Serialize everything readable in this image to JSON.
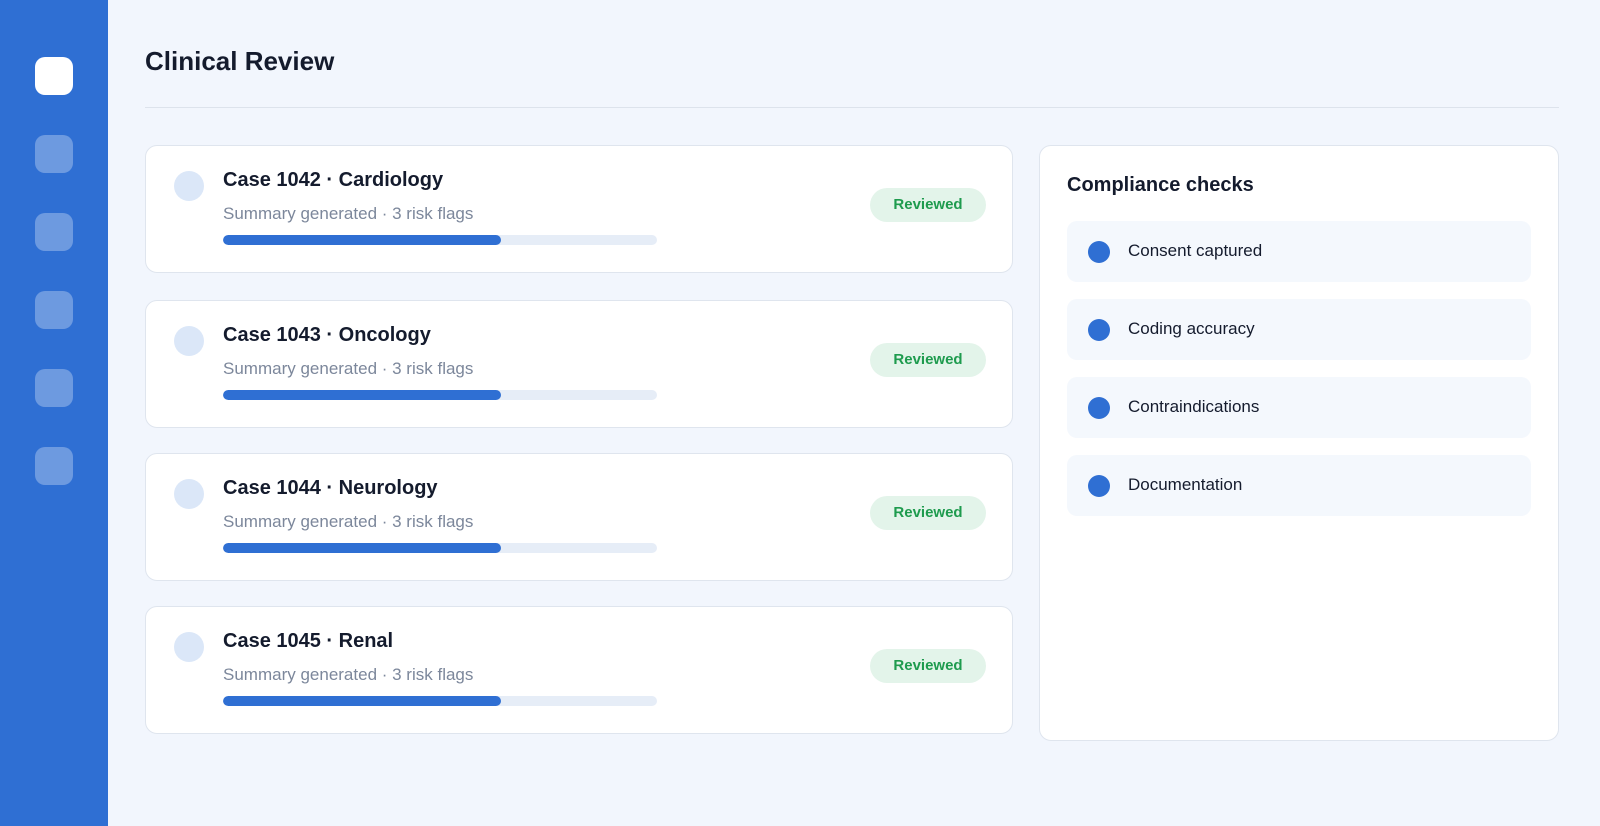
{
  "sidebar": {
    "items": [
      {
        "icon": "home-icon",
        "active": true
      },
      {
        "icon": "nav-icon",
        "active": false
      },
      {
        "icon": "nav-icon",
        "active": false
      },
      {
        "icon": "nav-icon",
        "active": false
      },
      {
        "icon": "nav-icon",
        "active": false
      },
      {
        "icon": "nav-icon",
        "active": false
      }
    ]
  },
  "header": {
    "title": "Clinical Review"
  },
  "cases": [
    {
      "title": "Case 1042 · Cardiology",
      "subtitle": "Summary generated · 3 risk flags",
      "progress": 0.64,
      "status": "Reviewed"
    },
    {
      "title": "Case 1043 · Oncology",
      "subtitle": "Summary generated · 3 risk flags",
      "progress": 0.64,
      "status": "Reviewed"
    },
    {
      "title": "Case 1044 · Neurology",
      "subtitle": "Summary generated · 3 risk flags",
      "progress": 0.64,
      "status": "Reviewed"
    },
    {
      "title": "Case 1045 · Renal",
      "subtitle": "Summary generated · 3 risk flags",
      "progress": 0.64,
      "status": "Reviewed"
    }
  ],
  "compliance": {
    "title": "Compliance checks",
    "items": [
      {
        "label": "Consent captured"
      },
      {
        "label": "Coding accuracy"
      },
      {
        "label": "Contraindications"
      },
      {
        "label": "Documentation"
      }
    ]
  },
  "colors": {
    "accent": "#2f6fd3",
    "status_bg": "#e3f4ea",
    "status_text": "#1e9b4e",
    "page_bg": "#f2f6fd"
  }
}
